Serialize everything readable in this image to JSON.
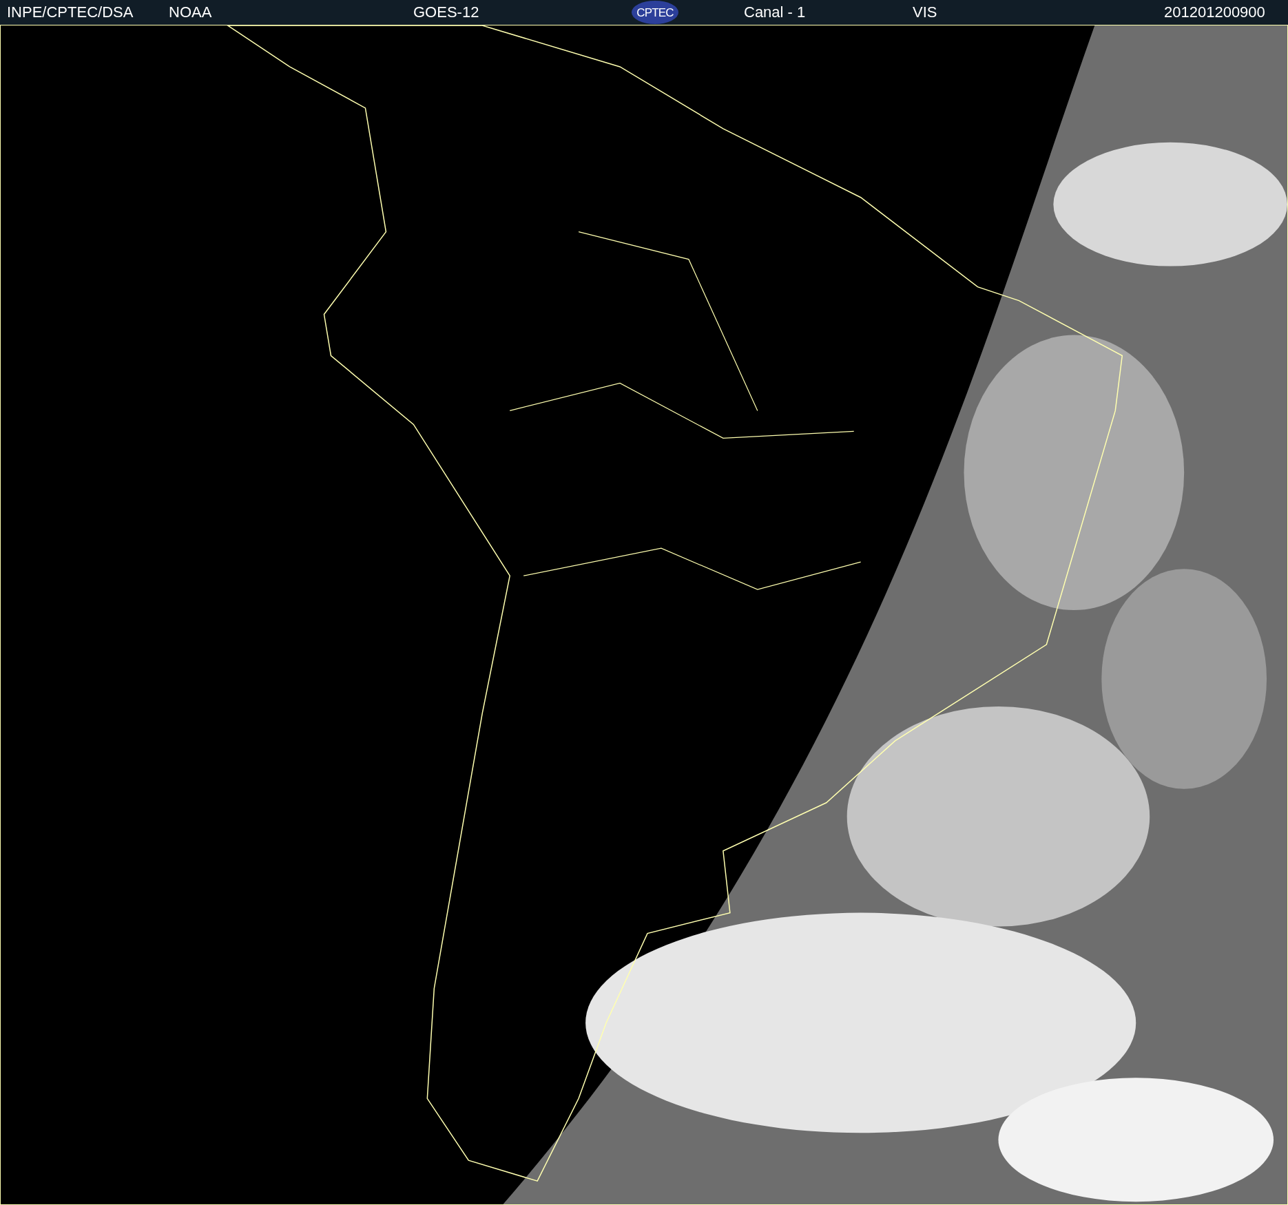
{
  "header": {
    "agency": "INPE/CPTEC/DSA",
    "source": "NOAA",
    "satellite": "GOES-12",
    "logo_text": "CPTEC",
    "channel": "Canal - 1",
    "band": "VIS",
    "timestamp": "201201200900"
  }
}
